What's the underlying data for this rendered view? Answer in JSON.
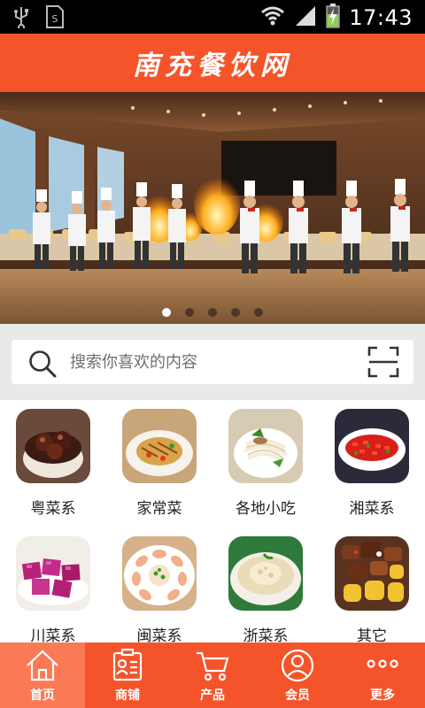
{
  "status_bar": {
    "time": "17:43",
    "icons": [
      "usb-icon",
      "sim-card-icon",
      "wifi-icon",
      "signal-icon",
      "battery-charging-icon"
    ]
  },
  "header": {
    "title": "南充餐饮网",
    "color": "#f5542b"
  },
  "banner": {
    "image": "chefs-flambe-banquet-hall",
    "slide_count": 5,
    "active_slide": 1
  },
  "search": {
    "placeholder": "搜索你喜欢的内容",
    "search_icon": "search-icon",
    "scan_icon": "scan-icon"
  },
  "categories": [
    {
      "label": "粤菜系",
      "image": "braised-mushroom-dish"
    },
    {
      "label": "家常菜",
      "image": "stir-fry-plate"
    },
    {
      "label": "各地小吃",
      "image": "noodle-bowl"
    },
    {
      "label": "湘菜系",
      "image": "steamed-fish-chili"
    },
    {
      "label": "川菜系",
      "image": "pink-jelly-cubes"
    },
    {
      "label": "闽菜系",
      "image": "shrimp-platter"
    },
    {
      "label": "浙菜系",
      "image": "soup-bowl"
    },
    {
      "label": "其它",
      "image": "braised-meat-potatoes"
    }
  ],
  "bottom_nav": [
    {
      "label": "首页",
      "icon": "home-icon",
      "active": true
    },
    {
      "label": "商铺",
      "icon": "store-id-icon",
      "active": false
    },
    {
      "label": "产品",
      "icon": "cart-icon",
      "active": false
    },
    {
      "label": "会员",
      "icon": "user-icon",
      "active": false
    },
    {
      "label": "更多",
      "icon": "more-icon",
      "active": false
    }
  ],
  "colors": {
    "accent": "#f5542b",
    "nav_active": "#fa7a55"
  }
}
